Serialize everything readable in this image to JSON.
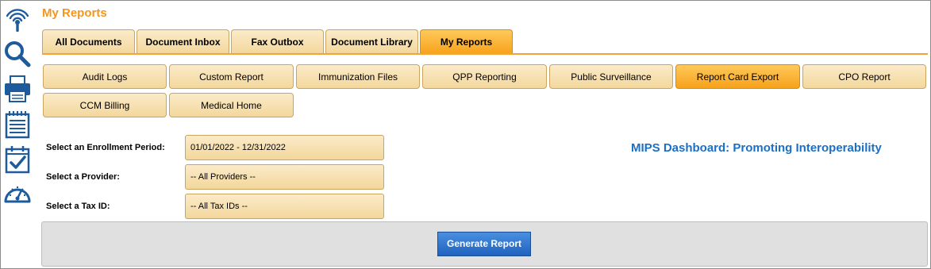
{
  "app": {
    "title": "My Reports"
  },
  "rail": {
    "icons": [
      "broadcast-icon",
      "search-icon",
      "printer-icon",
      "notepad-icon",
      "checklist-icon",
      "dashboard-gauge-icon"
    ],
    "color": "#1e5b9c"
  },
  "main_tabs": [
    {
      "label": "All Documents",
      "active": false
    },
    {
      "label": "Document Inbox",
      "active": false
    },
    {
      "label": "Fax Outbox",
      "active": false
    },
    {
      "label": "Document Library",
      "active": false
    },
    {
      "label": "My Reports",
      "active": true
    }
  ],
  "sub_tabs": [
    {
      "label": "Audit Logs",
      "active": false
    },
    {
      "label": "Custom Report",
      "active": false
    },
    {
      "label": "Immunization Files",
      "active": false
    },
    {
      "label": "QPP Reporting",
      "active": false
    },
    {
      "label": "Public Surveillance",
      "active": false
    },
    {
      "label": "Report Card Export",
      "active": true
    },
    {
      "label": "CPO Report",
      "active": false
    },
    {
      "label": "CCM Billing",
      "active": false
    },
    {
      "label": "Medical Home",
      "active": false
    }
  ],
  "form": {
    "enrollment_label": "Select an Enrollment Period:",
    "enrollment_value": "01/01/2022 - 12/31/2022",
    "provider_label": "Select a Provider:",
    "provider_value": "-- All Providers --",
    "tax_label": "Select a Tax ID:",
    "tax_value": "-- All Tax IDs --"
  },
  "dashboard_title": "MIPS Dashboard: Promoting Interoperability",
  "generate_button": "Generate Report",
  "colors": {
    "accent": "#f4961e",
    "link_blue": "#1b6fc4",
    "button_blue": "#1f62c0"
  }
}
